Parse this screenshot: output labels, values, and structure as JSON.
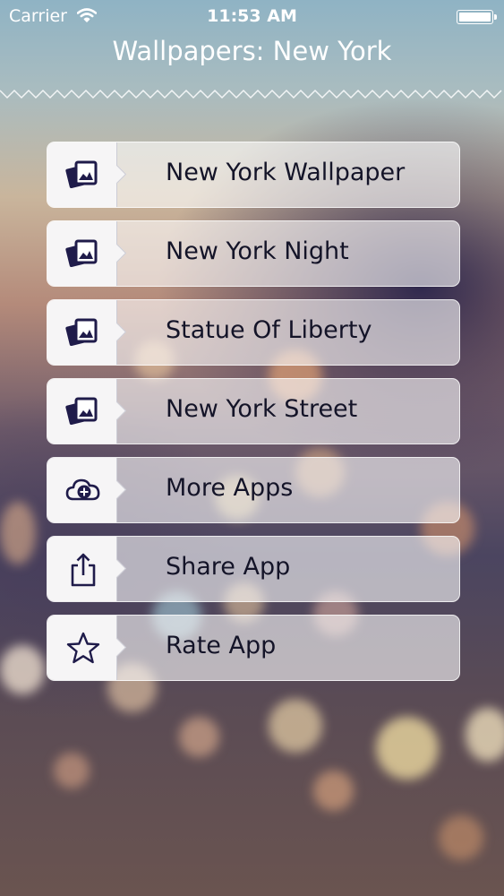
{
  "status_bar": {
    "carrier": "Carrier",
    "time": "11:53 AM"
  },
  "header": {
    "title": "Wallpapers: New York"
  },
  "colors": {
    "icon": "#1f1b4a",
    "label": "#141428",
    "row_bg": "rgba(255,255,255,0.6)"
  },
  "menu": {
    "items": [
      {
        "label": "New York Wallpaper",
        "icon": "photos-icon"
      },
      {
        "label": "New York Night",
        "icon": "photos-icon"
      },
      {
        "label": "Statue Of Liberty",
        "icon": "photos-icon"
      },
      {
        "label": "New York Street",
        "icon": "photos-icon"
      },
      {
        "label": "More Apps",
        "icon": "cloud-plus-icon"
      },
      {
        "label": "Share App",
        "icon": "share-icon"
      },
      {
        "label": "Rate App",
        "icon": "star-icon"
      }
    ]
  }
}
